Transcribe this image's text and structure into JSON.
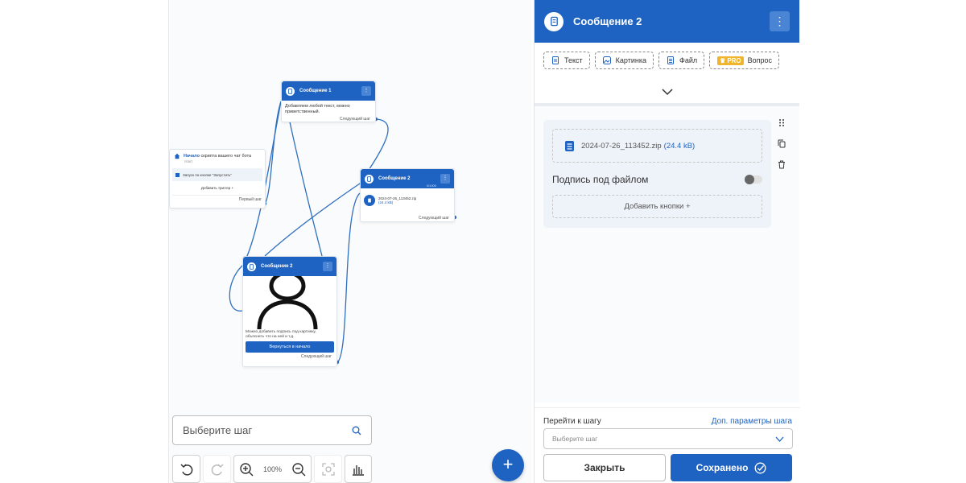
{
  "canvas": {
    "start_node": {
      "title_link": "Начало",
      "title_rest": "скрипта вашего чат бота",
      "subtitle": "/start",
      "trigger": "Запуск по кнопке \"Запустить\"",
      "add_trigger": "Добавить триггер  +",
      "footer": "Первый шаг"
    },
    "message1": {
      "title": "Сообщение 1",
      "menu": "⋮",
      "text": "Добавляем любой текст, можно приветственный.",
      "footer": "Следующий шаг"
    },
    "message2_file": {
      "title": "Сообщение 2",
      "menu": "⋮",
      "counter": "0/1000",
      "file_name": "2024-07-26_113452.zip",
      "file_size": "(24.4 kB)",
      "footer": "Следующий шаг"
    },
    "message2_image": {
      "title": "Сообщение 2",
      "menu": "⋮",
      "caption": "Можно добавить подпись под картинку, объяснить что на ней и т.д.",
      "button": "Вернуться в начало",
      "footer": "Следующий шаг"
    }
  },
  "bottom": {
    "search_placeholder": "Выберите шаг",
    "zoom": "100%",
    "fab": "+"
  },
  "panel": {
    "title": "Сообщение 2",
    "menu": "⋮",
    "tools": {
      "text": "Текст",
      "image": "Картинка",
      "file": "Файл",
      "pro_badge": "PRO",
      "question": "Вопрос"
    },
    "file": {
      "name": "2024-07-26_113452.zip",
      "size": "(24.4 kB)"
    },
    "caption_label": "Подпись под файлом",
    "caption_enabled": false,
    "add_buttons": "Добавить кнопки  +",
    "goto_label": "Перейти к шагу",
    "goto_link": "Доп. параметры шага",
    "goto_placeholder": "Выберите шаг",
    "close_button": "Закрыть",
    "save_button": "Сохранено"
  },
  "colors": {
    "accent": "#1e63c2",
    "pro": "#f0b52c"
  }
}
